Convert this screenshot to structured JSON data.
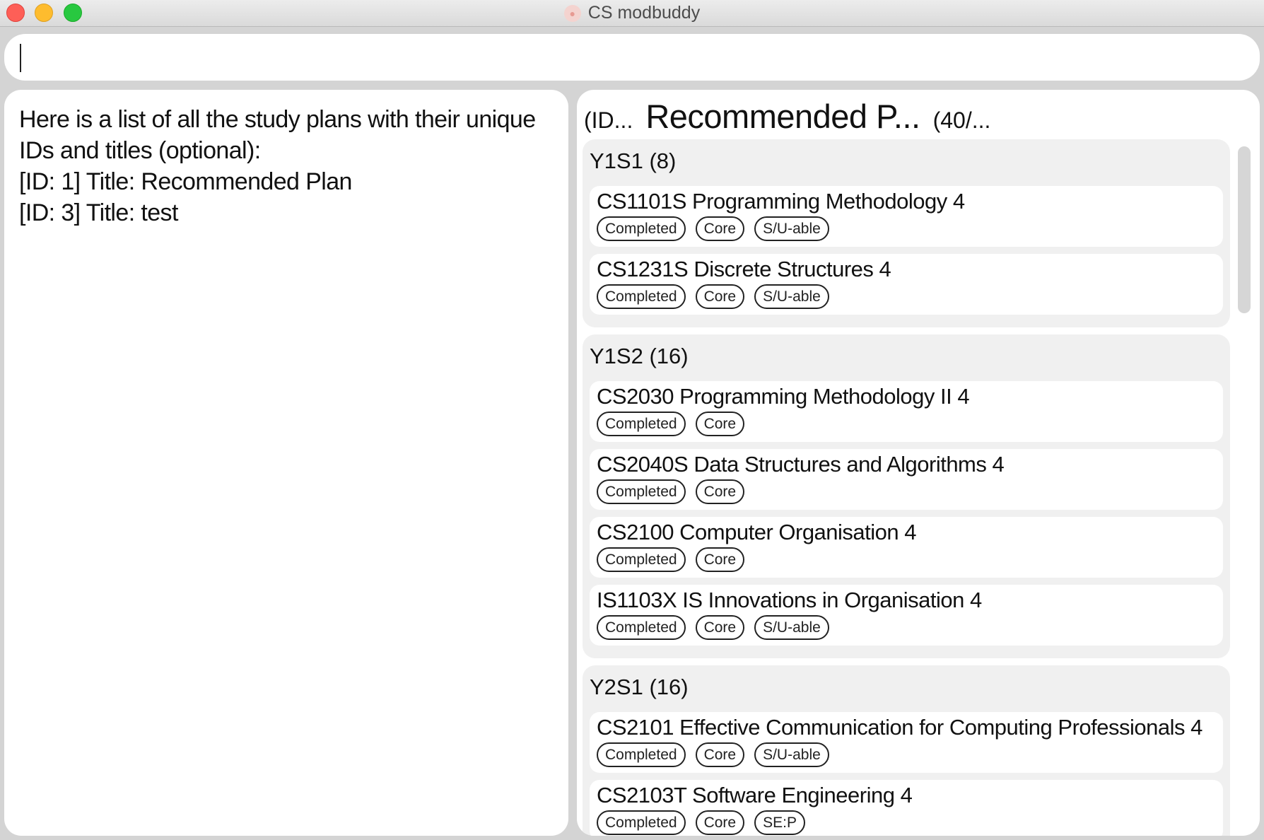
{
  "window": {
    "title": "CS modbuddy",
    "app_icon": "paw-icon"
  },
  "command": {
    "value": "",
    "placeholder": ""
  },
  "result": {
    "lines": [
      "Here is a list of all the study plans with their unique",
      "IDs and titles (optional):",
      "[ID: 1] Title: Recommended Plan",
      "[ID: 3] Title: test"
    ]
  },
  "plan": {
    "id_label": "(ID...",
    "title": "Recommended P...",
    "credits": "(40/..."
  },
  "semesters": [
    {
      "name": "Y1S1",
      "credits": "(8)",
      "modules": [
        {
          "code": "CS1101S",
          "title": "Programming Methodology",
          "mc": "4",
          "tags": [
            "Completed",
            "Core",
            "S/U-able"
          ]
        },
        {
          "code": "CS1231S",
          "title": "Discrete Structures",
          "mc": "4",
          "tags": [
            "Completed",
            "Core",
            "S/U-able"
          ]
        }
      ]
    },
    {
      "name": "Y1S2",
      "credits": "(16)",
      "modules": [
        {
          "code": "CS2030",
          "title": "Programming Methodology II",
          "mc": "4",
          "tags": [
            "Completed",
            "Core"
          ]
        },
        {
          "code": "CS2040S",
          "title": "Data Structures and Algorithms",
          "mc": "4",
          "tags": [
            "Completed",
            "Core"
          ]
        },
        {
          "code": "CS2100",
          "title": "Computer Organisation",
          "mc": "4",
          "tags": [
            "Completed",
            "Core"
          ]
        },
        {
          "code": "IS1103X",
          "title": "IS Innovations in Organisation",
          "mc": "4",
          "tags": [
            "Completed",
            "Core",
            "S/U-able"
          ]
        }
      ]
    },
    {
      "name": "Y2S1",
      "credits": "(16)",
      "modules": [
        {
          "code": "CS2101",
          "title": "Effective Communication for Computing Professionals",
          "mc": "4",
          "tags": [
            "Completed",
            "Core",
            "S/U-able"
          ]
        },
        {
          "code": "CS2103T",
          "title": "Software Engineering",
          "mc": "4",
          "tags": [
            "Completed",
            "Core",
            "SE:P"
          ]
        }
      ]
    }
  ],
  "colors": {
    "close": "#fe5f57",
    "minimize": "#febc2e",
    "maximize": "#28c840",
    "panel_bg": "#ffffff",
    "semester_bg": "#f0f0f0"
  }
}
